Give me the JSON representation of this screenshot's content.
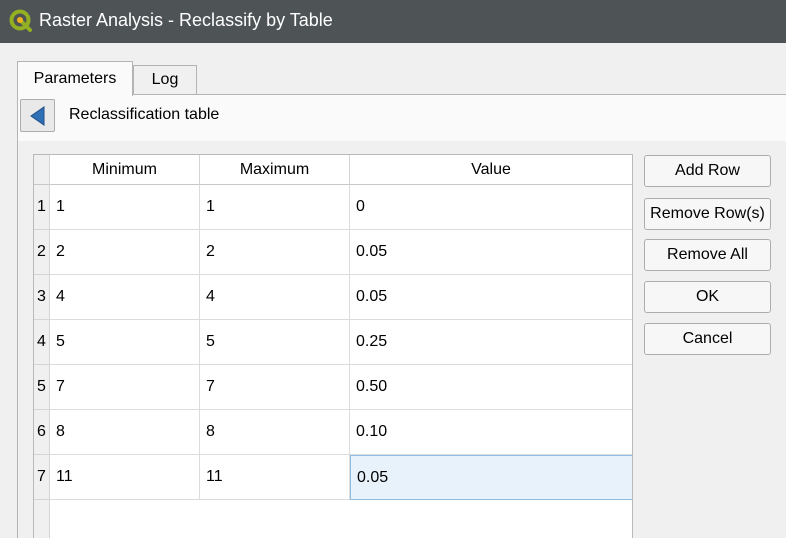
{
  "window": {
    "title": "Raster Analysis - Reclassify by Table",
    "logo": "qgis-logo"
  },
  "tabs": [
    {
      "label": "Parameters",
      "active": true
    },
    {
      "label": "Log",
      "active": false
    }
  ],
  "section": {
    "title": "Reclassification table",
    "back_icon": "triangle-left-icon"
  },
  "table": {
    "columns": [
      "Minimum",
      "Maximum",
      "Value"
    ],
    "rows": [
      {
        "num": "1",
        "min": "1",
        "max": "1",
        "value": "0"
      },
      {
        "num": "2",
        "min": "2",
        "max": "2",
        "value": "0.05"
      },
      {
        "num": "3",
        "min": "4",
        "max": "4",
        "value": "0.05"
      },
      {
        "num": "4",
        "min": "5",
        "max": "5",
        "value": "0.25"
      },
      {
        "num": "5",
        "min": "7",
        "max": "7",
        "value": "0.50"
      },
      {
        "num": "6",
        "min": "8",
        "max": "8",
        "value": "0.10"
      },
      {
        "num": "7",
        "min": "11",
        "max": "11",
        "value": "0.05"
      }
    ],
    "selected_cell": {
      "row": 7,
      "column": "Value"
    }
  },
  "buttons": {
    "add_row": "Add Row",
    "remove_rows": "Remove Row(s)",
    "remove_all": "Remove All",
    "ok": "OK",
    "cancel": "Cancel"
  },
  "colors": {
    "titlebar": "#4e5356",
    "back_arrow": "#2e6fb5",
    "selection": "#e8f2fb",
    "logo_green": "#93b023"
  }
}
